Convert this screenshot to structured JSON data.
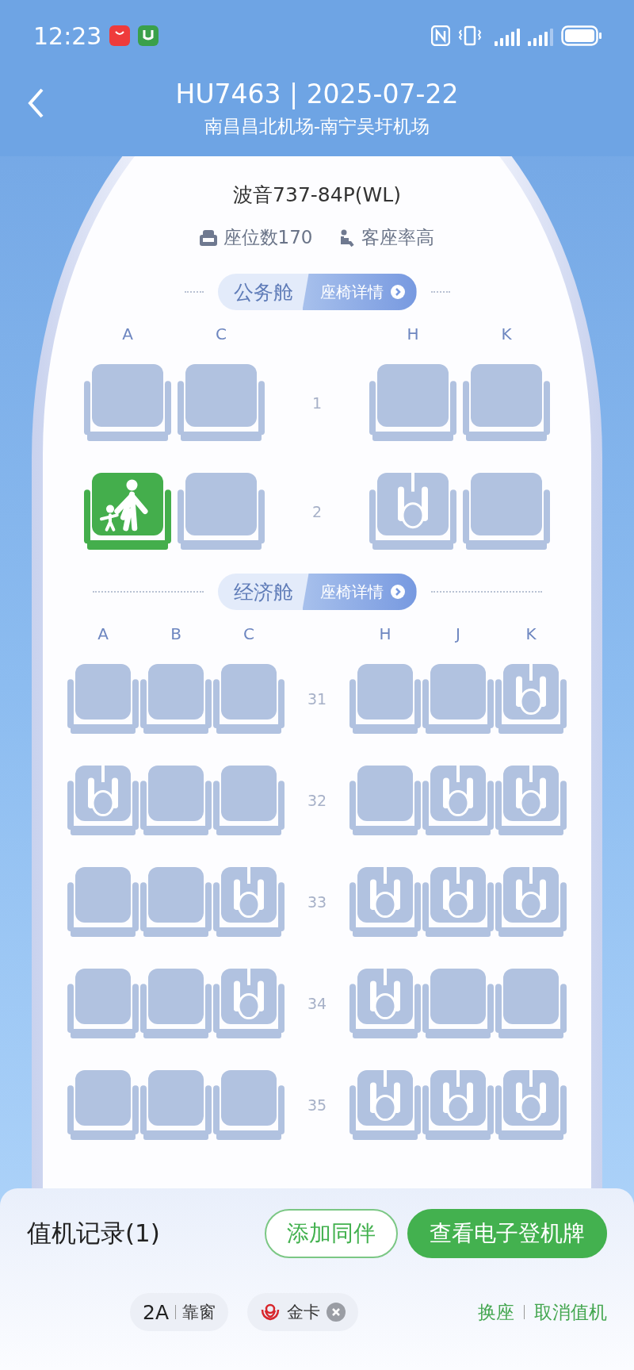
{
  "status_bar": {
    "time": "12:23"
  },
  "header": {
    "title": "HU7463 | 2025-07-22",
    "route": "南昌昌北机场-南宁吴圩机场"
  },
  "aircraft": {
    "model": "波音737-84P(WL)",
    "seat_count": "座位数170",
    "load": "客座率高"
  },
  "cabins": [
    {
      "kind": "business",
      "name": "公务舱",
      "details": "座椅详情",
      "left_columns": [
        "A",
        "C"
      ],
      "right_columns": [
        "H",
        "K"
      ],
      "rows": [
        {
          "number": "1",
          "left": [
            {
              "kind": "empty"
            },
            {
              "kind": "empty"
            }
          ],
          "right": [
            {
              "kind": "empty"
            },
            {
              "kind": "empty"
            }
          ]
        },
        {
          "number": "2",
          "left": [
            {
              "kind": "mine"
            },
            {
              "kind": "empty"
            }
          ],
          "right": [
            {
              "kind": "occupied"
            },
            {
              "kind": "empty"
            }
          ]
        }
      ]
    },
    {
      "kind": "economy",
      "name": "经济舱",
      "details": "座椅详情",
      "left_columns": [
        "A",
        "B",
        "C"
      ],
      "right_columns": [
        "H",
        "J",
        "K"
      ],
      "rows": [
        {
          "number": "31",
          "left": [
            {
              "kind": "empty"
            },
            {
              "kind": "empty"
            },
            {
              "kind": "empty"
            }
          ],
          "right": [
            {
              "kind": "empty"
            },
            {
              "kind": "empty"
            },
            {
              "kind": "occupied"
            }
          ]
        },
        {
          "number": "32",
          "left": [
            {
              "kind": "occupied"
            },
            {
              "kind": "empty"
            },
            {
              "kind": "empty"
            }
          ],
          "right": [
            {
              "kind": "empty"
            },
            {
              "kind": "occupied"
            },
            {
              "kind": "occupied"
            }
          ]
        },
        {
          "number": "33",
          "left": [
            {
              "kind": "empty"
            },
            {
              "kind": "empty"
            },
            {
              "kind": "occupied"
            }
          ],
          "right": [
            {
              "kind": "occupied"
            },
            {
              "kind": "occupied"
            },
            {
              "kind": "occupied"
            }
          ]
        },
        {
          "number": "34",
          "left": [
            {
              "kind": "empty"
            },
            {
              "kind": "empty"
            },
            {
              "kind": "occupied"
            }
          ],
          "right": [
            {
              "kind": "occupied"
            },
            {
              "kind": "empty"
            },
            {
              "kind": "empty"
            }
          ]
        },
        {
          "number": "35",
          "left": [
            {
              "kind": "empty"
            },
            {
              "kind": "empty"
            },
            {
              "kind": "empty"
            }
          ],
          "right": [
            {
              "kind": "occupied"
            },
            {
              "kind": "occupied"
            },
            {
              "kind": "occupied"
            }
          ]
        }
      ]
    }
  ],
  "checkin": {
    "title": "值机记录(1)",
    "buttons": [
      {
        "label": "添加同伴",
        "kind": "outline"
      },
      {
        "label": "查看电子登机牌",
        "kind": "filled"
      }
    ],
    "seat": "2A",
    "seat_type": "靠窗",
    "membership": "金卡",
    "actions": [
      "换座",
      "取消值机"
    ]
  }
}
